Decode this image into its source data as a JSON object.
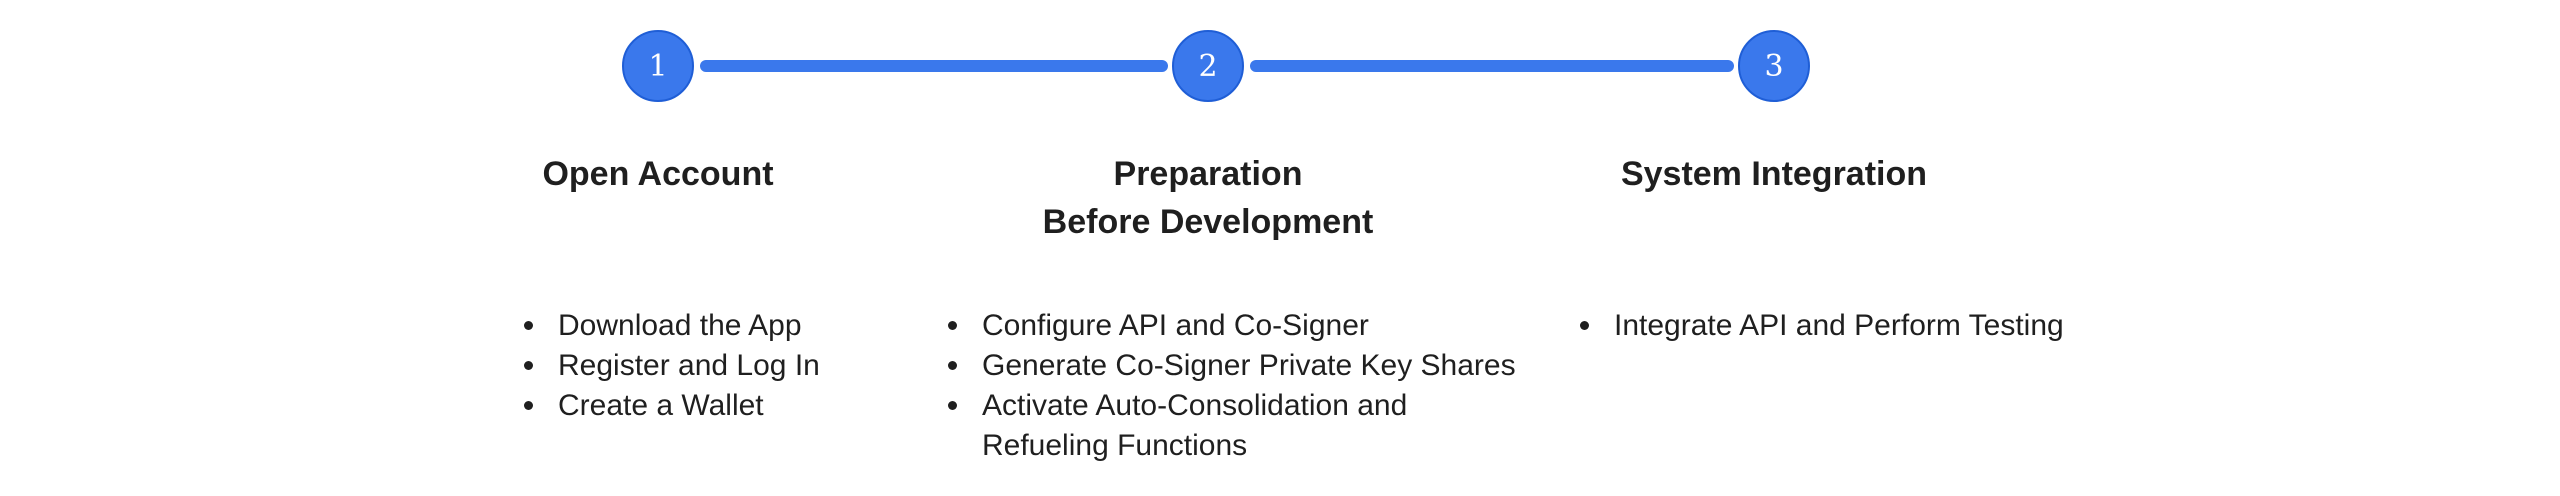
{
  "colors": {
    "accent": "#3a78ec",
    "accent_border": "#1f5ed6",
    "text": "#1f1f1f"
  },
  "steps": [
    {
      "number": "1",
      "title": "Open Account",
      "items": [
        "Download the App",
        "Register and Log In",
        "Create a Wallet"
      ]
    },
    {
      "number": "2",
      "title": "Preparation\nBefore Development",
      "items": [
        "Configure API and Co-Signer",
        "Generate Co-Signer Private Key Shares",
        "Activate Auto-Consolidation and\nRefueling Functions"
      ]
    },
    {
      "number": "3",
      "title": "System Integration",
      "items": [
        "Integrate API and Perform Testing"
      ]
    }
  ]
}
